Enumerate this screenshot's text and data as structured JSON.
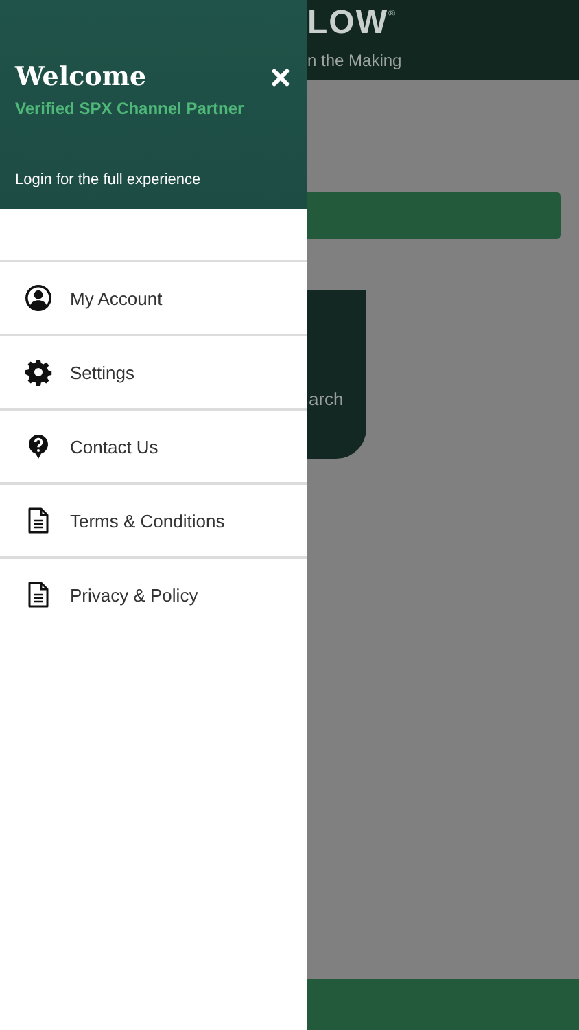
{
  "background": {
    "logo": "LOW",
    "logo_mark": "®",
    "tagline": "n the Making",
    "card_text": "arch"
  },
  "drawer": {
    "title": "Welcome",
    "subtitle": "Verified SPX Channel Partner",
    "login_hint": "Login for the full experience",
    "items": [
      {
        "label": "My Account",
        "kind": "account"
      },
      {
        "label": "Settings",
        "kind": "gear"
      },
      {
        "label": "Contact Us",
        "kind": "help"
      },
      {
        "label": "Terms & Conditions",
        "kind": "document"
      },
      {
        "label": "Privacy & Policy",
        "kind": "document"
      }
    ]
  }
}
